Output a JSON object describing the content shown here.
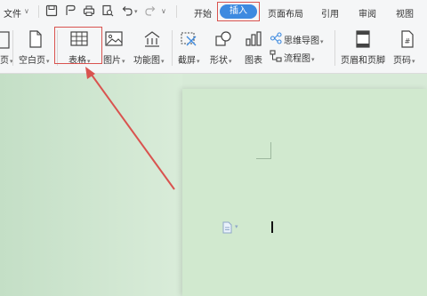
{
  "menubar": {
    "file_label": "文件",
    "tabs": [
      "开始",
      "插入",
      "页面布局",
      "引用",
      "审阅",
      "视图"
    ],
    "active_tab": "插入"
  },
  "ribbon": {
    "page_partial": "页",
    "blank_page": "空白页",
    "table": "表格",
    "picture": "图片",
    "function_chart": "功能图",
    "screenshot": "截屏",
    "shape": "形状",
    "chart": "图表",
    "mind_map": "思维导图",
    "flowchart": "流程图",
    "header_footer": "页眉和页脚",
    "page_number": "页码"
  },
  "colors": {
    "accent": "#3d8ae0",
    "highlight": "#d9534f",
    "page_bg": "#d1e9cf"
  }
}
